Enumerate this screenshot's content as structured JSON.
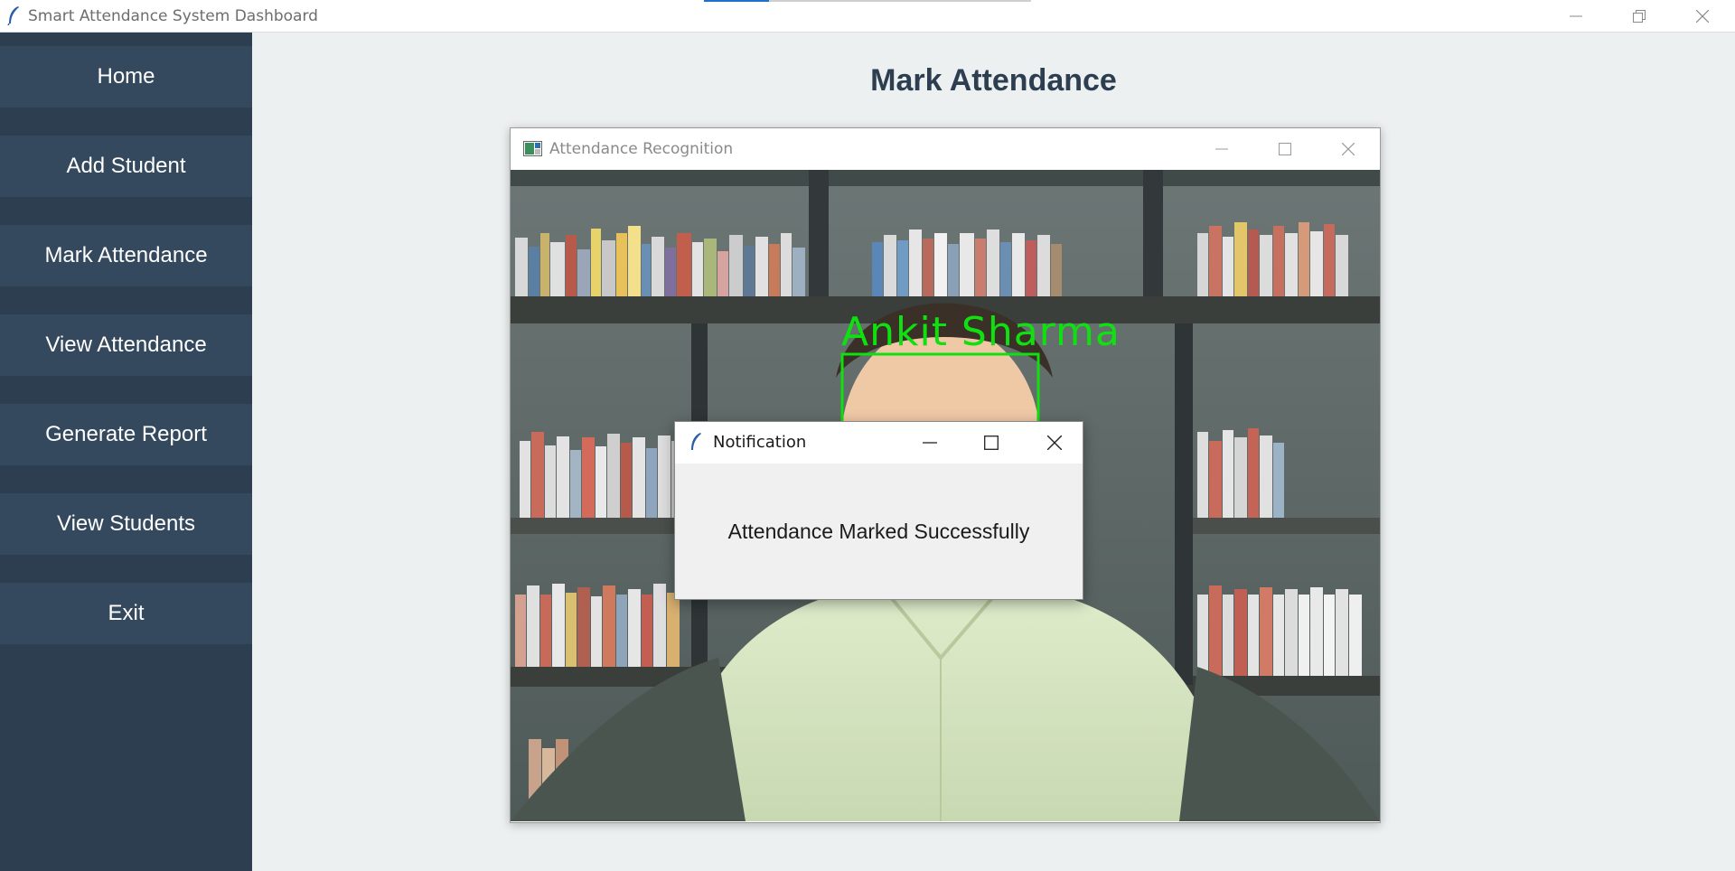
{
  "window": {
    "title": "Smart Attendance System Dashboard",
    "controls": [
      "minimize-icon",
      "restore-icon",
      "close-icon"
    ]
  },
  "sidebar": {
    "items": [
      {
        "label": "Home"
      },
      {
        "label": "Add Student"
      },
      {
        "label": "Mark Attendance"
      },
      {
        "label": "View Attendance"
      },
      {
        "label": "Generate Report"
      },
      {
        "label": "View Students"
      },
      {
        "label": "Exit"
      }
    ]
  },
  "main": {
    "title": "Mark Attendance"
  },
  "recognition_window": {
    "title": "Attendance Recognition",
    "detected_name": "Ankit  Sharma"
  },
  "notification": {
    "title": "Notification",
    "message": "Attendance Marked Successfully"
  },
  "colors": {
    "sidebar_bg": "#2c3e50",
    "button_bg": "#34495e",
    "content_bg": "#ecf0f1",
    "title_text": "#2c3e50",
    "detection_green": "#10e010"
  }
}
